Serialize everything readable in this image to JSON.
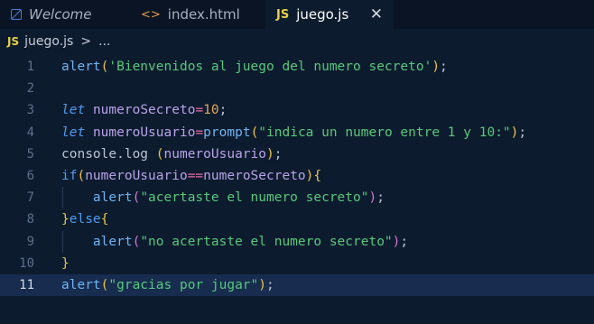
{
  "tabs": [
    {
      "label": "Welcome",
      "icon": "welcome-icon"
    },
    {
      "label": "index.html",
      "icon": "html-icon",
      "icon_text": "<>"
    },
    {
      "label": "juego.js",
      "icon": "js-icon",
      "icon_text": "JS",
      "active": true,
      "close": "✕"
    }
  ],
  "breadcrumb": {
    "icon_text": "JS",
    "file": "juego.js",
    "separator": ">",
    "more": "..."
  },
  "editor": {
    "active_line": 11,
    "lines": [
      {
        "n": "1",
        "tokens": [
          [
            "fn",
            "alert"
          ],
          [
            "br1",
            "("
          ],
          [
            "str",
            "'Bienvenidos al juego del numero secreto'"
          ],
          [
            "br1",
            ")"
          ],
          [
            "punc",
            ";"
          ]
        ]
      },
      {
        "n": "2",
        "tokens": []
      },
      {
        "n": "3",
        "tokens": [
          [
            "kw",
            "let"
          ],
          [
            "punc",
            " "
          ],
          [
            "var",
            "numeroSecreto"
          ],
          [
            "op",
            "="
          ],
          [
            "num",
            "10"
          ],
          [
            "punc",
            ";"
          ]
        ]
      },
      {
        "n": "4",
        "tokens": [
          [
            "kw",
            "let"
          ],
          [
            "punc",
            " "
          ],
          [
            "var",
            "numeroUsuario"
          ],
          [
            "op",
            "="
          ],
          [
            "fn",
            "prompt"
          ],
          [
            "br1",
            "("
          ],
          [
            "str",
            "\"indica un numero entre 1 y 10:\""
          ],
          [
            "br1",
            ")"
          ],
          [
            "punc",
            ";"
          ]
        ]
      },
      {
        "n": "5",
        "tokens": [
          [
            "punc",
            "console"
          ],
          [
            "punc",
            "."
          ],
          [
            "punc",
            "log "
          ],
          [
            "br1",
            "("
          ],
          [
            "var",
            "numeroUsuario"
          ],
          [
            "br1",
            ")"
          ],
          [
            "punc",
            ";"
          ]
        ]
      },
      {
        "n": "6",
        "tokens": [
          [
            "kw2",
            "if"
          ],
          [
            "br1",
            "("
          ],
          [
            "var",
            "numeroUsuario"
          ],
          [
            "op",
            "=="
          ],
          [
            "var",
            "numeroSecreto"
          ],
          [
            "br1",
            ")"
          ],
          [
            "br1",
            "{"
          ]
        ]
      },
      {
        "n": "7",
        "indent": true,
        "tokens": [
          [
            "punc",
            "    "
          ],
          [
            "fn",
            "alert"
          ],
          [
            "br2",
            "("
          ],
          [
            "str",
            "\"acertaste el numero secreto\""
          ],
          [
            "br2",
            ")"
          ],
          [
            "punc",
            ";"
          ]
        ]
      },
      {
        "n": "8",
        "tokens": [
          [
            "br1",
            "}"
          ],
          [
            "kw2",
            "else"
          ],
          [
            "br1",
            "{"
          ]
        ]
      },
      {
        "n": "9",
        "indent": true,
        "tokens": [
          [
            "punc",
            "    "
          ],
          [
            "fn",
            "alert"
          ],
          [
            "br2",
            "("
          ],
          [
            "str",
            "\"no acertaste el numero secreto\""
          ],
          [
            "br2",
            ")"
          ],
          [
            "punc",
            ";"
          ]
        ]
      },
      {
        "n": "10",
        "tokens": [
          [
            "br1",
            "}"
          ]
        ]
      },
      {
        "n": "11",
        "tokens": [
          [
            "fn",
            "alert"
          ],
          [
            "br1",
            "("
          ],
          [
            "str",
            "\"gracias por jugar\""
          ],
          [
            "br1",
            ")"
          ],
          [
            "punc",
            ";"
          ]
        ]
      }
    ]
  }
}
